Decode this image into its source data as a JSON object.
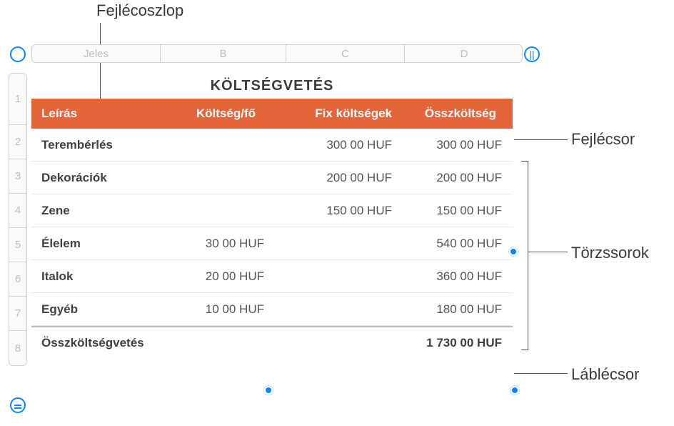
{
  "callouts": {
    "header_column": "Fejlécoszlop",
    "header_row": "Fejlécsor",
    "body_rows": "Törzssorok",
    "footer_row": "Láblécsor"
  },
  "columns": {
    "A": "Jeles",
    "B": "B",
    "C": "C",
    "D": "D"
  },
  "row_numbers": [
    "1",
    "2",
    "3",
    "4",
    "5",
    "6",
    "7",
    "8"
  ],
  "table": {
    "title": "KÖLTSÉGVETÉS",
    "headers": {
      "desc": "Leírás",
      "per_person": "Költség/fő",
      "fixed": "Fix költségek",
      "total": "Összköltség"
    },
    "rows": [
      {
        "desc": "Terembérlés",
        "per": "",
        "fixed": "300 00 HUF",
        "total": "300 00 HUF"
      },
      {
        "desc": "Dekorációk",
        "per": "",
        "fixed": "200 00 HUF",
        "total": "200 00 HUF"
      },
      {
        "desc": "Zene",
        "per": "",
        "fixed": "150 00 HUF",
        "total": "150 00 HUF"
      },
      {
        "desc": "Élelem",
        "per": "30 00 HUF",
        "fixed": "",
        "total": "540 00 HUF"
      },
      {
        "desc": "Italok",
        "per": "20 00 HUF",
        "fixed": "",
        "total": "360 00 HUF"
      },
      {
        "desc": "Egyéb",
        "per": "10 00 HUF",
        "fixed": "",
        "total": "180 00 HUF"
      }
    ],
    "footer": {
      "label": "Összköltségvetés",
      "total": "1 730 00 HUF"
    }
  },
  "controls": {
    "add_column": "||"
  }
}
